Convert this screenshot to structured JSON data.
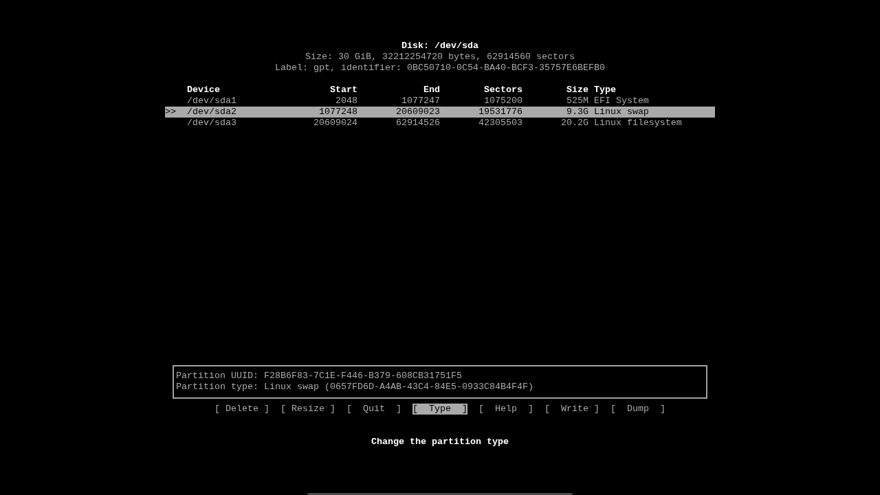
{
  "disk": {
    "title": "Disk: /dev/sda",
    "size_line": "Size: 30 GiB, 32212254720 bytes, 62914560 sectors",
    "label_line": "Label: gpt, identifier: 0BC50710-0C54-BA40-BCF3-35757E6BEFB0"
  },
  "table": {
    "cursor": ">>",
    "columns": [
      "Device",
      "Start",
      "End",
      "Sectors",
      "Size",
      "Type"
    ],
    "rows": [
      {
        "cells": [
          "/dev/sda1",
          "2048",
          "1077247",
          "1075200",
          "525M",
          "EFI System"
        ],
        "selected": false
      },
      {
        "cells": [
          "/dev/sda2",
          "1077248",
          "20609023",
          "19531776",
          "9.3G",
          "Linux swap"
        ],
        "selected": true
      },
      {
        "cells": [
          "/dev/sda3",
          "20609024",
          "62914526",
          "42305503",
          "20.2G",
          "Linux filesystem"
        ],
        "selected": false
      }
    ]
  },
  "info_box": {
    "lines": [
      "Partition UUID: F28B6F83-7C1E-F446-B379-608CB31751F5",
      "Partition type: Linux swap (0657FD6D-A4AB-43C4-84E5-0933C84B4F4F)"
    ]
  },
  "actions": [
    {
      "label": "[ Delete ]",
      "selected": false
    },
    {
      "label": "[ Resize ]",
      "selected": false
    },
    {
      "label": "[  Quit  ]",
      "selected": false
    },
    {
      "label": "[  Type  ]",
      "selected": true
    },
    {
      "label": "[  Help  ]",
      "selected": false
    },
    {
      "label": "[  Write ]",
      "selected": false
    },
    {
      "label": "[  Dump  ]",
      "selected": false
    }
  ],
  "hint": "Change the partition type"
}
